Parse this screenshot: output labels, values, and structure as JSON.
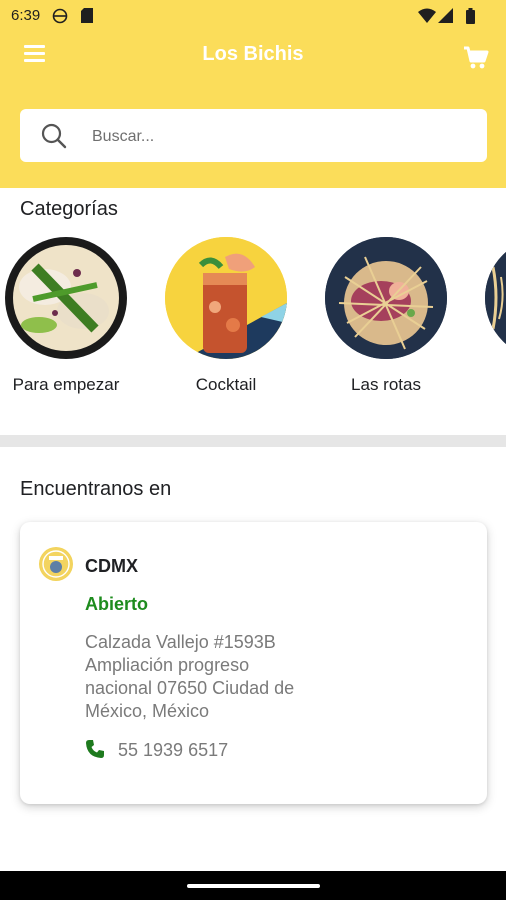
{
  "status_bar": {
    "time": "6:39"
  },
  "app_bar": {
    "title": "Los Bichis"
  },
  "search": {
    "placeholder": "Buscar..."
  },
  "categories": {
    "title": "Categorías",
    "items": [
      {
        "label": "Para empezar"
      },
      {
        "label": "Cocktail"
      },
      {
        "label": "Las rotas"
      }
    ]
  },
  "locations": {
    "title": "Encuentranos en",
    "card": {
      "city": "CDMX",
      "status": "Abierto",
      "address": "Calzada Vallejo #1593B Ampliación progreso nacional 07650 Ciudad de México, México",
      "phone": "55 1939 6517"
    }
  },
  "colors": {
    "brand_yellow": "#fbdd5a",
    "open_green": "#1e8c1e"
  }
}
